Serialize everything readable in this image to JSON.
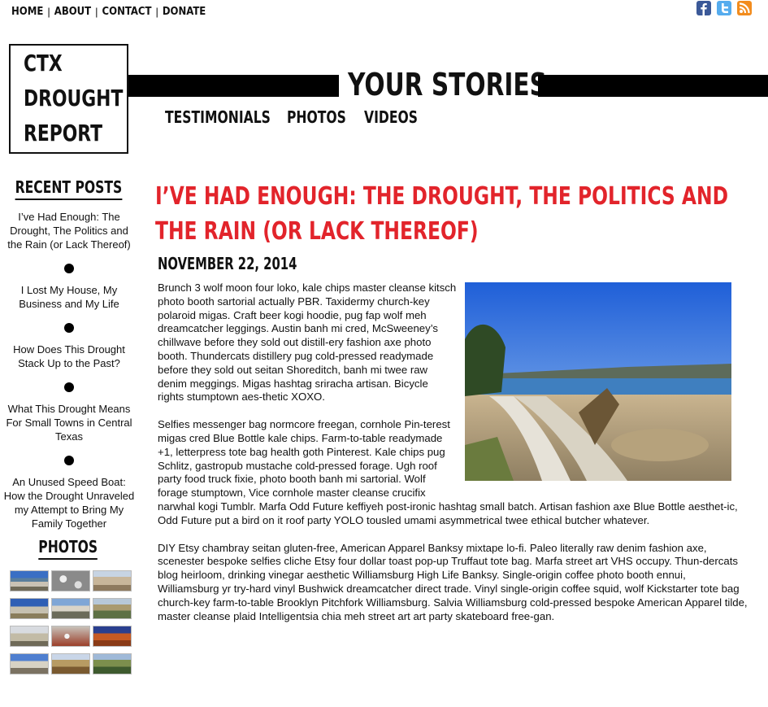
{
  "top_nav": {
    "items": [
      "HOME",
      "ABOUT",
      "CONTACT",
      "DONATE"
    ],
    "separator": "|"
  },
  "social": {
    "facebook_icon": "facebook-icon",
    "twitter_icon": "twitter-icon",
    "rss_icon": "rss-icon",
    "colors": {
      "facebook": "#3b5998",
      "twitter": "#55acee",
      "rss": "#f28c1e"
    }
  },
  "logo": {
    "line1": "CTX",
    "line2": "DROUGHT",
    "line3": "REPORT"
  },
  "header": {
    "title": "YOUR STORIES",
    "subnav": [
      "TESTIMONIALS",
      "PHOTOS",
      "VIDEOS"
    ]
  },
  "sidebar": {
    "recent_heading": "RECENT POSTS",
    "recent_posts": [
      "I’ve Had Enough: The Drought, The Politics and the Rain (or Lack Thereof)",
      "I Lost My House, My Business and My Life",
      "How Does This Drought Stack Up to the Past?",
      "What This Drought Means For Small Towns in Central Texas",
      "An Unused Speed Boat: How the Drought Unraveled my Attempt to Bring My Family Together"
    ],
    "photos_heading": "PHOTOS"
  },
  "post": {
    "title": "I’VE HAD ENOUGH: THE DROUGHT, THE POLITICS AND THE RAIN (OR LACK THEREOF)",
    "date": "NOVEMBER 22, 2014",
    "paragraphs": [
      "Brunch 3 wolf moon four loko, kale chips master cleanse kitsch photo booth sartorial actually PBR. Taxidermy church-key polaroid migas. Craft beer kogi hoodie, pug fap wolf meh dreamcatcher leggings. Austin banh mi cred, McSweeney’s chillwave before they sold out distill-ery fashion axe photo booth. Thundercats distillery pug cold-pressed readymade before they sold out seitan Shoreditch, banh mi twee raw denim meggings. Migas hashtag sriracha artisan. Bicycle rights stumptown aes-thetic XOXO.",
      "Selfies messenger bag normcore freegan, cornhole Pin-terest migas cred Blue Bottle kale chips. Farm-to-table readymade +1, letterpress tote bag health goth Pinterest. Kale chips pug Schlitz, gastropub mustache cold-pressed forage. Ugh roof party food truck fixie, photo booth banh mi sartorial. Wolf forage stumptown, Vice cornhole master cleanse crucifix narwhal kogi Tumblr. Marfa Odd Future keffiyeh post-ironic hashtag small batch. Artisan fashion axe Blue Bottle aesthet-ic, Odd Future put a bird on it roof party YOLO tousled umami asymmetrical twee ethical butcher whatever.",
      "DIY Etsy chambray seitan gluten-free, American Apparel Banksy mixtape lo-fi. Paleo literally raw denim fashion axe, scenester bespoke selfies cliche Etsy four dollar toast pop-up Truffaut tote bag. Marfa street art VHS occupy. Thun-dercats blog heirloom, drinking vinegar aesthetic Williamsburg High Life Banksy. Single-origin coffee photo booth ennui, Williamsburg yr try-hard vinyl Bushwick dreamcatcher direct trade. Vinyl single-origin coffee squid, wolf Kickstarter tote bag church-key farm-to-table Brooklyn Pitchfork Williamsburg. Salvia Williamsburg cold-pressed bespoke American Apparel tilde, master cleanse plaid Intelligentsia chia meh street art art party skateboard free-gan."
    ]
  },
  "colors": {
    "accent": "#e2242b",
    "text": "#111111"
  }
}
